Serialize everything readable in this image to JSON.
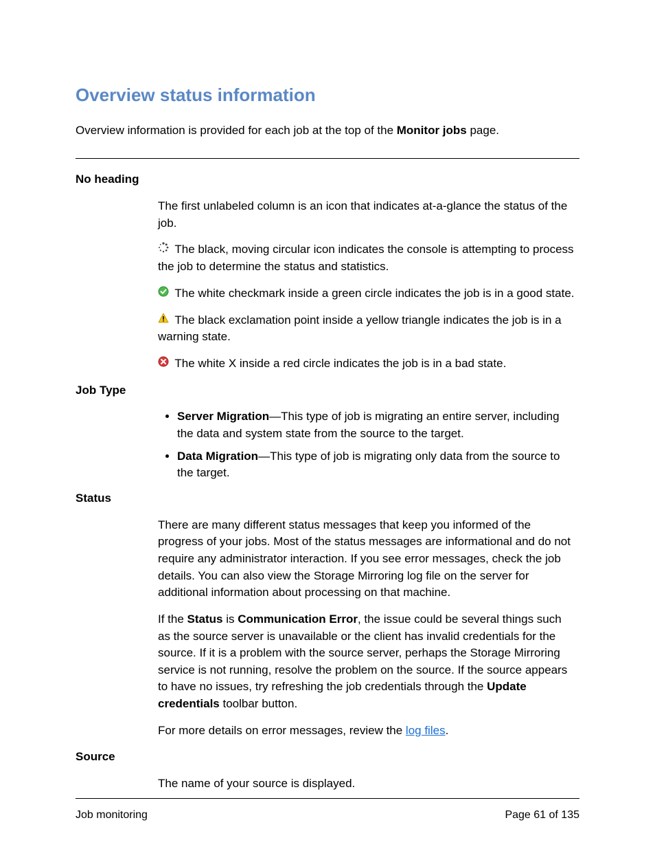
{
  "title": "Overview status information",
  "intro_before": "Overview information is provided for each job at the top of the ",
  "intro_bold": "Monitor jobs",
  "intro_after": " page.",
  "sections": {
    "no_heading": {
      "label": "No heading",
      "p1": "The first unlabeled column is an icon that indicates at-a-glance the status of the job.",
      "icon_moving": " The black, moving circular icon indicates the console is attempting to process the job to determine the status and statistics.",
      "icon_green": " The white checkmark inside a green circle indicates the job is in a good state.",
      "icon_yellow": " The black exclamation point inside a yellow triangle indicates the job is in a warning state.",
      "icon_red": " The white X inside a red circle indicates the job is in a bad state."
    },
    "job_type": {
      "label": "Job Type",
      "items": [
        {
          "bold": "Server Migration",
          "text": "—This type of job is migrating an entire server, including the data and system state from the source to the target."
        },
        {
          "bold": "Data Migration",
          "text": "—This type of job is migrating only data from the source to the target."
        }
      ]
    },
    "status": {
      "label": "Status",
      "p1": "There are many different status messages that keep you informed of the progress of your jobs. Most of the status messages are informational and do not require any administrator interaction. If you see error messages, check the job details. You can also view the Storage Mirroring log file on the server for additional information about processing on that machine.",
      "p2_before": "If the ",
      "p2_b1": "Status",
      "p2_mid": " is ",
      "p2_b2": "Communication Error",
      "p2_after": ", the issue could be several things such as the source server is unavailable or the client has invalid credentials for the source. If it is a problem with the source server, perhaps the Storage Mirroring service is not running, resolve the problem on the source. If the source appears to have no issues, try refreshing the job credentials through the ",
      "p2_b3": "Update credentials",
      "p2_end": " toolbar button.",
      "p3_before": "For more details on error messages, review the ",
      "p3_link": "log files",
      "p3_after": "."
    },
    "source": {
      "label": "Source",
      "p1": "The name of your source is displayed."
    }
  },
  "footer": {
    "left": "Job monitoring",
    "right": "Page 61 of 135"
  }
}
